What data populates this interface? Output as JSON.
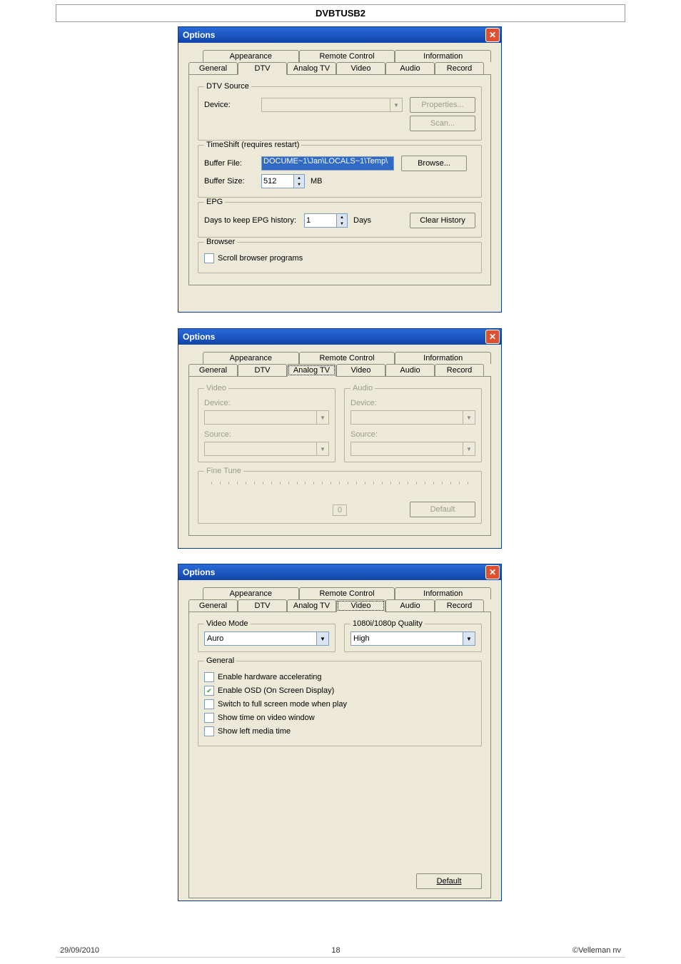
{
  "header": {
    "title": "DVBTUSB2"
  },
  "footer": {
    "date": "29/09/2010",
    "page": "18",
    "company": "©Velleman nv"
  },
  "dialogs": {
    "common": {
      "window_title": "Options",
      "close": "✕",
      "tabs_row1": {
        "appearance": "Appearance",
        "remote": "Remote Control",
        "information": "Information"
      },
      "tabs_row2": {
        "general": "General",
        "dtv": "DTV",
        "analogtv": "Analog TV",
        "video": "Video",
        "audio": "Audio",
        "record": "Record"
      }
    },
    "d1": {
      "dtv_source": {
        "title": "DTV Source",
        "device": "Device:",
        "properties": "Properties...",
        "scan": "Scan..."
      },
      "timeshift": {
        "title": "TimeShift (requires restart)",
        "buffer_file": "Buffer File:",
        "buffer_file_value": "DOCUME~1\\Jan\\LOCALS~1\\Temp\\",
        "browse": "Browse...",
        "buffer_size": "Buffer Size:",
        "buffer_size_value": "512",
        "mb": "MB"
      },
      "epg": {
        "title": "EPG",
        "days_label": "Days to keep EPG history:",
        "days_value": "1",
        "days_unit": "Days",
        "clear": "Clear History"
      },
      "browser": {
        "title": "Browser",
        "scroll": "Scroll browser programs"
      }
    },
    "d2": {
      "video": {
        "title": "Video",
        "device": "Device:",
        "source": "Source:"
      },
      "audio": {
        "title": "Audio",
        "device": "Device:",
        "source": "Source:"
      },
      "finetune": {
        "title": "Fine Tune",
        "value": "0",
        "default": "Default"
      }
    },
    "d3": {
      "videomode": {
        "title": "Video Mode",
        "value": "Auro"
      },
      "quality": {
        "title": "1080i/1080p Quality",
        "value": "High"
      },
      "general": {
        "title": "General",
        "chk1": "Enable hardware accelerating",
        "chk2": "Enable OSD (On Screen Display)",
        "chk3": "Switch to full screen mode when play",
        "chk4": "Show time on video window",
        "chk5": "Show left media time"
      },
      "default_btn": "Default"
    }
  }
}
